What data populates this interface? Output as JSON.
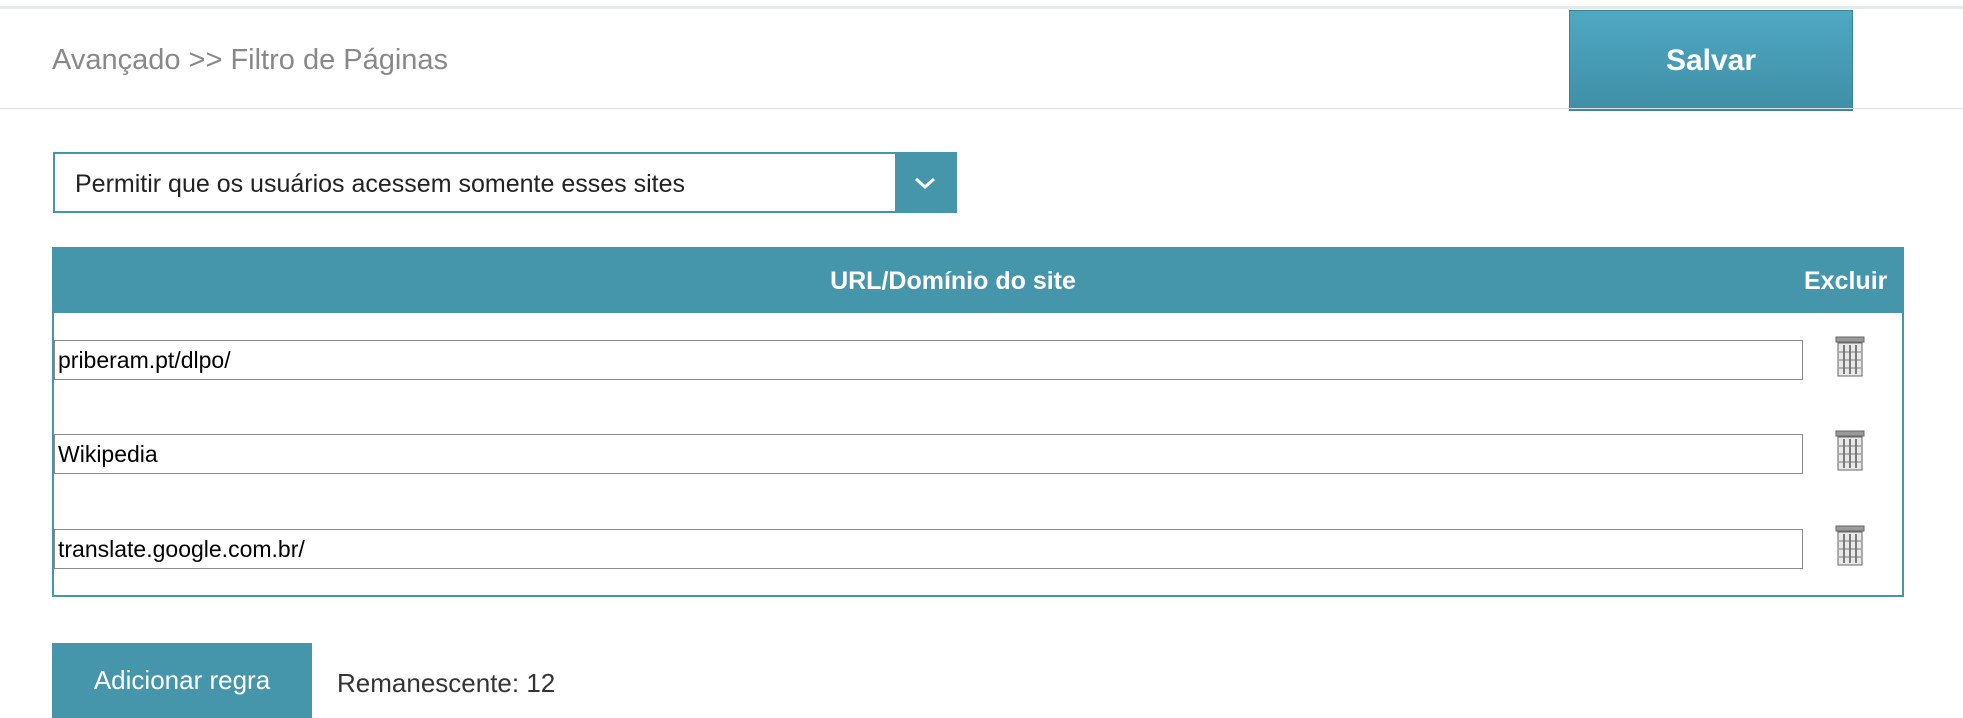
{
  "header": {
    "breadcrumb": "Avançado >> Filtro de Páginas",
    "save_label": "Salvar"
  },
  "filter_mode": {
    "selected": "Permitir que os usuários acessem somente esses sites",
    "arrow_icon": "chevron-down-icon"
  },
  "rules_table": {
    "col_url": "URL/Domínio do site",
    "col_delete": "Excluir",
    "delete_icon": "trash-icon",
    "rows": [
      {
        "url": "priberam.pt/dlpo/"
      },
      {
        "url": "Wikipedia"
      },
      {
        "url": "translate.google.com.br/"
      }
    ]
  },
  "footer": {
    "add_label": "Adicionar regra",
    "remaining_text": "Remanescente: 12"
  },
  "colors": {
    "accent": "#4596ab",
    "save_gradient_top": "#4fa8c2",
    "save_gradient_bottom": "#3f8fa6"
  }
}
